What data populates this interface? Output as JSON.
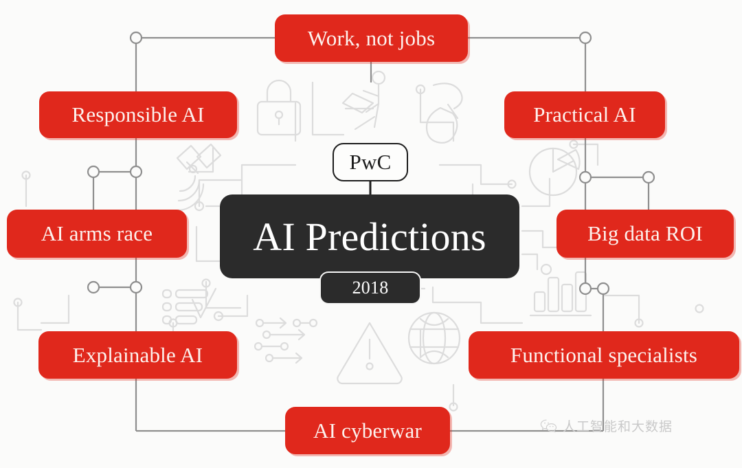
{
  "poster": {
    "center_title": "AI Predictions",
    "brand": "PwC",
    "year": "2018",
    "background_color": "#fbfbfa",
    "accent_color": "#e0281c",
    "center_color": "#2b2b2b",
    "connector_color": "#9a9a9a"
  },
  "nodes": [
    {
      "id": "work",
      "label": "Work, not jobs"
    },
    {
      "id": "responsible",
      "label": "Responsible AI"
    },
    {
      "id": "practical",
      "label": "Practical AI"
    },
    {
      "id": "arms",
      "label": "AI arms race"
    },
    {
      "id": "bigdata",
      "label": "Big data ROI"
    },
    {
      "id": "explainable",
      "label": "Explainable AI"
    },
    {
      "id": "functional",
      "label": "Functional specialists"
    },
    {
      "id": "cyberwar",
      "label": "AI cyberwar"
    }
  ],
  "watermark": {
    "text": "人工智能和大数据",
    "icon": "wechat-icon"
  },
  "background_icons": [
    "padlock-icon",
    "person-at-laptop-icon",
    "computer-mouse-icon",
    "satellite-dish-icon",
    "pie-chart-icon",
    "checklist-icon",
    "bar-chart-icon",
    "data-flow-arrows-icon",
    "warning-triangle-icon",
    "globe-network-icon"
  ]
}
